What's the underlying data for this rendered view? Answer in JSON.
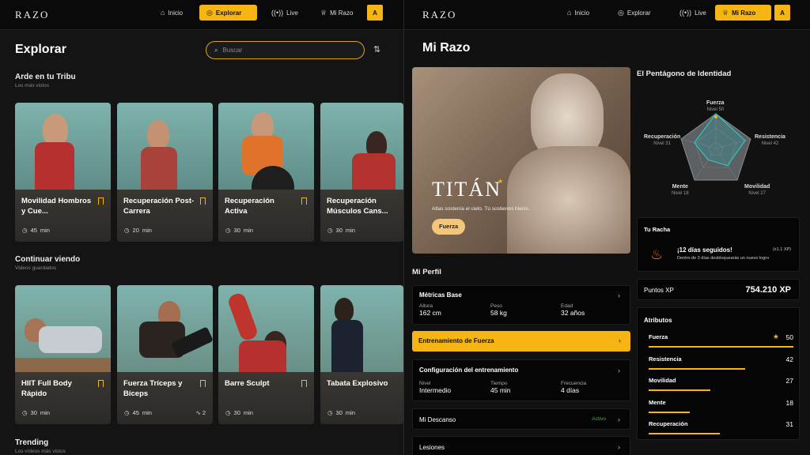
{
  "nav": {
    "logo": "RAZO",
    "items": [
      {
        "label": "Inicio",
        "icon": "home-icon"
      },
      {
        "label": "Explorar",
        "icon": "compass-icon"
      },
      {
        "label": "Live",
        "icon": "broadcast-icon"
      },
      {
        "label": "Mi Razo",
        "icon": "trophy-icon"
      }
    ],
    "avatar": "A"
  },
  "explore": {
    "title": "Explorar",
    "search_placeholder": "Buscar",
    "sections": [
      {
        "title": "Arde en tu Tribu",
        "subtitle": "Los más vistos",
        "cards": [
          {
            "title": "Movilidad Hombros y Cue...",
            "duration": "45",
            "unit": "min"
          },
          {
            "title": "Recuperación Post-Carrera",
            "duration": "20",
            "unit": "min"
          },
          {
            "title": "Recuperación Activa",
            "duration": "30",
            "unit": "min"
          },
          {
            "title": "Recuperación Músculos Cans...",
            "duration": "30",
            "unit": "min"
          }
        ]
      },
      {
        "title": "Continuar viendo",
        "subtitle": "Videos guardados",
        "cards": [
          {
            "title": "HIIT Full Body Rápido",
            "duration": "30",
            "unit": "min"
          },
          {
            "title": "Fuerza Tríceps y Bíceps",
            "duration": "45",
            "unit": "min",
            "extra": "2"
          },
          {
            "title": "Barre Sculpt",
            "duration": "30",
            "unit": "min"
          },
          {
            "title": "Tabata Explosivo",
            "duration": "30",
            "unit": "min"
          }
        ]
      },
      {
        "title": "Trending",
        "subtitle": "Los vídeos más vistos"
      }
    ]
  },
  "mirazo": {
    "title": "Mi Razo",
    "hero": {
      "name": "TITÁN",
      "tagline": "Atlas sostenía el cielo. Tú sostienes hierro.",
      "tag": "Fuerza"
    },
    "pentagon": {
      "title": "El Pentágono de Identidad",
      "axes": [
        {
          "name": "Fuerza",
          "level": "Nivel 50"
        },
        {
          "name": "Resistencia",
          "level": "Nivel 42"
        },
        {
          "name": "Movilidad",
          "level": "Nivel 27"
        },
        {
          "name": "Mente",
          "level": "Nivel 18"
        },
        {
          "name": "Recuperación",
          "level": "Nivel 31"
        }
      ]
    },
    "profile": {
      "title": "Mi Perfil",
      "metrics_title": "Métricas Base",
      "metrics": [
        {
          "label": "Altura",
          "value": "162 cm"
        },
        {
          "label": "Peso",
          "value": "58 kg"
        },
        {
          "label": "Edad",
          "value": "32 años"
        }
      ],
      "highlight": "Entrenamiento de Fuerza",
      "config_title": "Configuración del entrenamiento",
      "config": [
        {
          "label": "Nivel",
          "value": "Intermedio"
        },
        {
          "label": "Tiempo",
          "value": "45 min"
        },
        {
          "label": "Frecuencia",
          "value": "4 días"
        }
      ],
      "rest_label": "Mi Descanso",
      "rest_status": "Activo",
      "injuries_label": "Lesiones"
    },
    "streak": {
      "title": "Tu Racha",
      "headline": "¡12 días seguidos!",
      "multiplier": "(x1.1 XP)",
      "detail": "Dentro de 3 días desbloquearás un nuevo logro"
    },
    "xp": {
      "label": "Puntos XP",
      "value": "754.210 XP"
    },
    "attributes": {
      "title": "Atributos",
      "items": [
        {
          "name": "Fuerza",
          "value": "50",
          "level": 50,
          "starred": true
        },
        {
          "name": "Resistencia",
          "value": "42",
          "level": 42
        },
        {
          "name": "Movilidad",
          "value": "27",
          "level": 27
        },
        {
          "name": "Mente",
          "value": "18",
          "level": 18
        },
        {
          "name": "Recuperación",
          "value": "31",
          "level": 31
        }
      ]
    }
  },
  "colors": {
    "accent": "#f6b512",
    "bg": "#141414",
    "panel": "#050505",
    "active_green": "#4caf50"
  }
}
